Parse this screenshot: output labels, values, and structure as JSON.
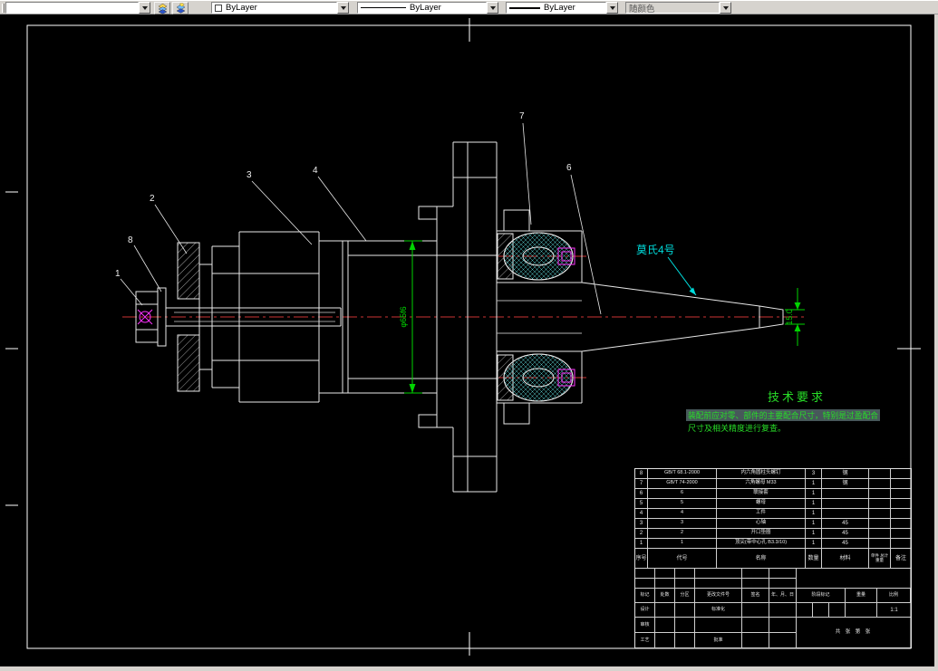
{
  "toolbar": {
    "layer_value": "",
    "color_value": "ByLayer",
    "linetype_value": "ByLayer",
    "lineweight_value": "ByLayer",
    "plotstyle_value": "随颜色"
  },
  "drawing": {
    "callouts": [
      {
        "label": "8"
      },
      {
        "label": "1"
      },
      {
        "label": "2"
      },
      {
        "label": "3"
      },
      {
        "label": "4"
      },
      {
        "label": "7"
      },
      {
        "label": "6"
      }
    ],
    "taper_label": "莫氏4号",
    "dim_phi": "φ65f6",
    "dim_tip": "15.0",
    "tech_requirements": {
      "title": "技术要求",
      "line1": "装配前应对零、部件的主要配合尺寸，特别是过盈配合",
      "line2": "尺寸及相关精度进行复查。"
    },
    "colors": {
      "dimension_green": "#00d400",
      "centerline_red": "#cc3333",
      "annotation_cyan": "#00dcdc",
      "tech_text_green": "#28dd28",
      "highlight_magenta": "#ff33ff"
    }
  },
  "title_block": {
    "parts_headers": {
      "no": "序号",
      "code": "代号",
      "name": "名称",
      "qty": "数量",
      "material": "材料",
      "weight_top": "单件 总计",
      "weight_bottom": "重量",
      "note": "备注"
    },
    "parts": [
      {
        "no": "8",
        "code": "GB/T 68.1-2000",
        "name": "内六角圆柱头螺钉",
        "qty": "3",
        "material": "钢",
        "note": ""
      },
      {
        "no": "7",
        "code": "GB/T 74-2000",
        "name": "六角螺母 M33",
        "qty": "1",
        "material": "钢",
        "note": ""
      },
      {
        "no": "6",
        "code": "6",
        "name": "联接套",
        "qty": "1",
        "material": "",
        "note": ""
      },
      {
        "no": "5",
        "code": "5",
        "name": "螺母",
        "qty": "1",
        "material": "",
        "note": ""
      },
      {
        "no": "4",
        "code": "4",
        "name": "工件",
        "qty": "1",
        "material": "",
        "note": ""
      },
      {
        "no": "3",
        "code": "3",
        "name": "心轴",
        "qty": "1",
        "material": "45",
        "note": ""
      },
      {
        "no": "2",
        "code": "2",
        "name": "开口垫圈",
        "qty": "1",
        "material": "45",
        "note": ""
      },
      {
        "no": "1",
        "code": "1",
        "name": "顶尖(带中心孔 B3.3/10)",
        "qty": "1",
        "material": "45",
        "note": ""
      }
    ],
    "revision_labels": {
      "mark": "标记",
      "count": "处数",
      "zone": "分区",
      "doc_no": "更改文件号",
      "sign": "签名",
      "date": "年、月、日"
    },
    "sign_labels": {
      "design": "设计",
      "standard": "标准化",
      "check": "审核",
      "process": "工艺",
      "approve": "批准"
    },
    "stage_labels": {
      "stage": "阶段标记",
      "weight": "重量",
      "scale": "比例",
      "scale_value": "1:1",
      "sheets": "共  张  第  张"
    }
  }
}
